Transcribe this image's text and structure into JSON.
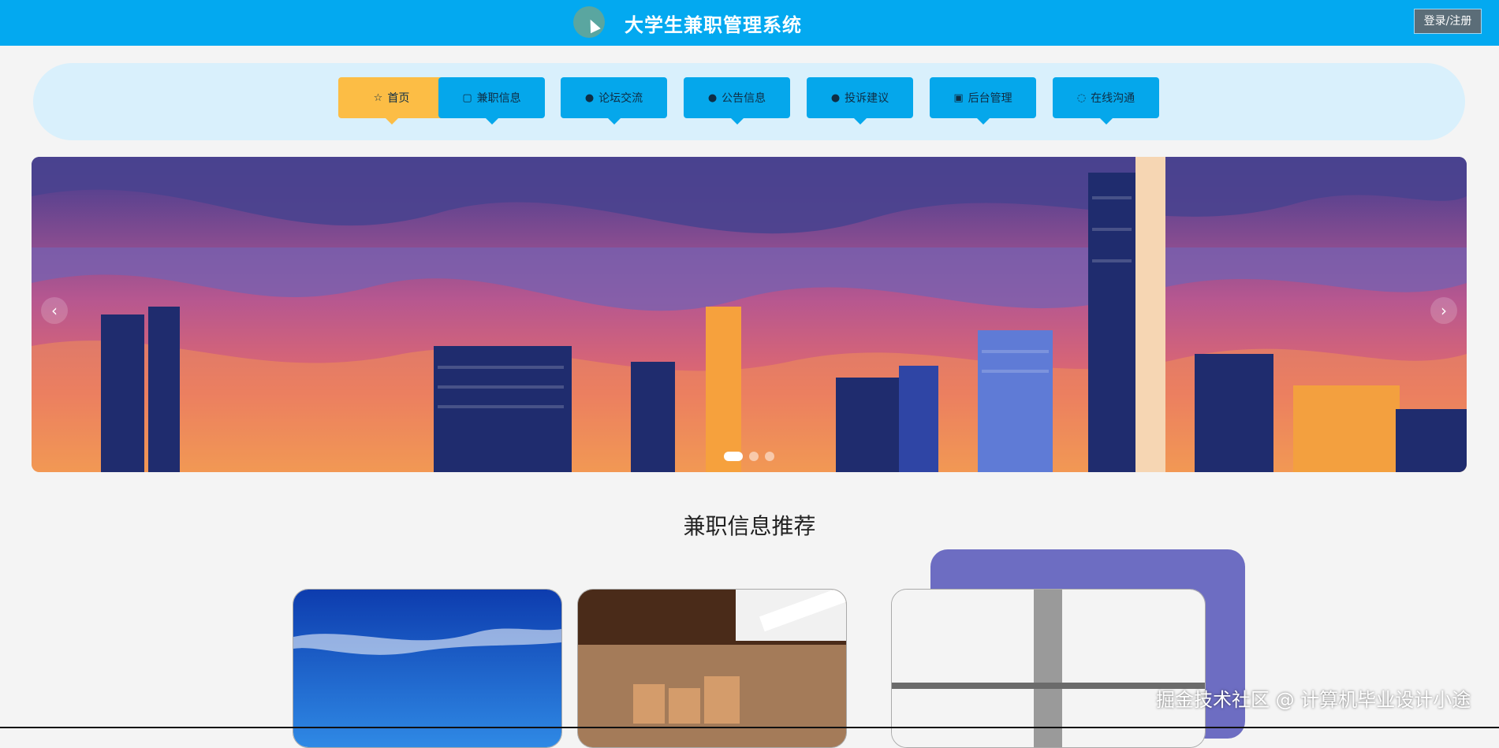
{
  "header": {
    "title": "大学生兼职管理系统",
    "login_label": "登录/注册"
  },
  "nav": {
    "items": [
      {
        "label": "首页",
        "icon": "star-icon"
      },
      {
        "label": "兼职信息",
        "icon": "bag-icon"
      },
      {
        "label": "论坛交流",
        "icon": "info-icon"
      },
      {
        "label": "公告信息",
        "icon": "question-icon"
      },
      {
        "label": "投诉建议",
        "icon": "info-icon"
      },
      {
        "label": "后台管理",
        "icon": "briefcase-icon"
      },
      {
        "label": "在线沟通",
        "icon": "headset-icon"
      }
    ]
  },
  "carousel": {
    "prev": "‹",
    "next": "›",
    "slides": 3,
    "active": 1
  },
  "section": {
    "title": "兼职信息推荐"
  },
  "watermark": "掘金技术社区 @ 计算机毕业设计小途",
  "colors": {
    "header": "#03a9f0",
    "nav_bg": "#d9f0fc",
    "nav_item": "#05a7eb",
    "nav_active": "#fcbd45",
    "accent_purple": "#6d6dc2"
  }
}
